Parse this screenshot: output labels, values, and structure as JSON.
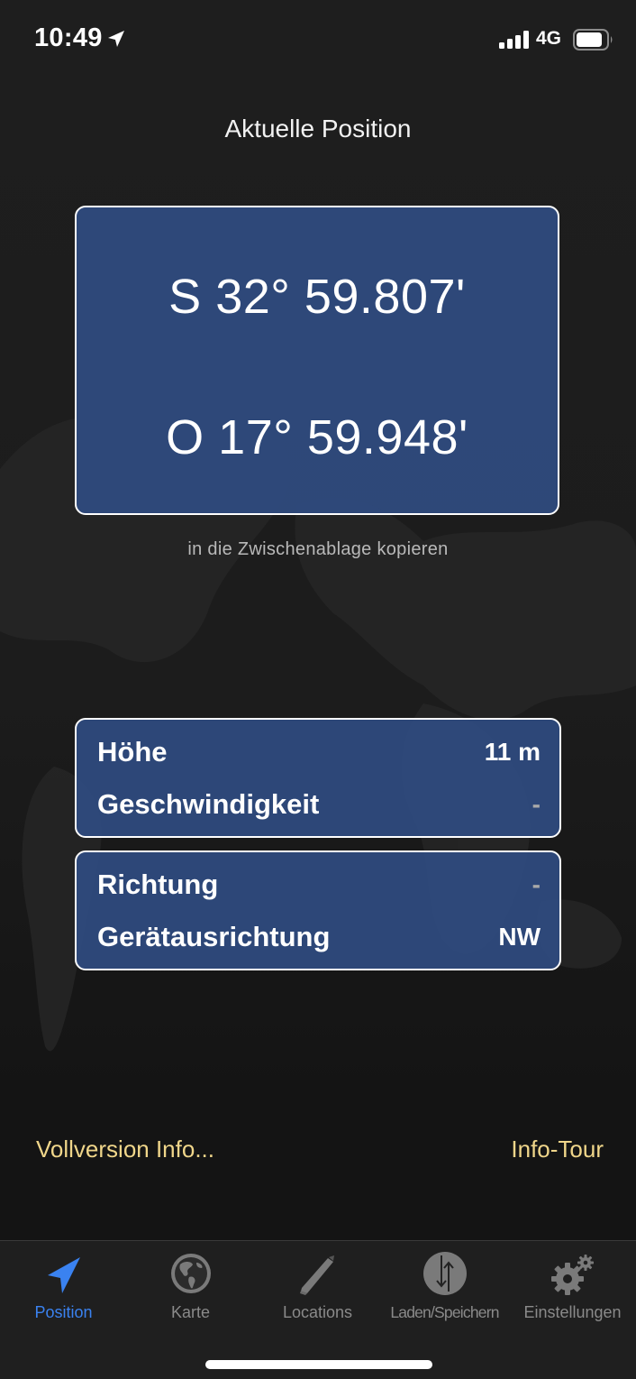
{
  "status_bar": {
    "time": "10:49",
    "network": "4G",
    "icons": [
      "location-arrow-icon",
      "signal-bars-icon",
      "battery-icon"
    ]
  },
  "header": {
    "title": "Aktuelle Position"
  },
  "coordinates": {
    "latitude": "S 32° 59.807'",
    "longitude": "O 17° 59.948'",
    "copy_label": "in die Zwischenablage kopieren"
  },
  "info_cards": [
    {
      "rows": [
        {
          "label": "Höhe",
          "value": "11 m"
        },
        {
          "label": "Geschwindigkeit",
          "value": "-"
        }
      ]
    },
    {
      "rows": [
        {
          "label": "Richtung",
          "value": "-"
        },
        {
          "label": "Gerätausrichtung",
          "value": "NW"
        }
      ]
    }
  ],
  "footer_links": {
    "full_version": "Vollversion Info...",
    "tour": "Info-Tour"
  },
  "tab_bar": {
    "active": "Position",
    "tabs": [
      {
        "label": "Position",
        "icon": "navigation-arrow-icon"
      },
      {
        "label": "Karte",
        "icon": "globe-icon"
      },
      {
        "label": "Locations",
        "icon": "pencil-icon"
      },
      {
        "label": "Laden/Speichern",
        "icon": "load-save-arrows-icon"
      },
      {
        "label": "Einstellungen",
        "icon": "gears-icon"
      }
    ]
  },
  "colors": {
    "background": "#1b1b1b",
    "card_fill": "#2e497c",
    "card_border": "#ffffff",
    "link_gold": "#f0d68a",
    "tab_active": "#3a82f0",
    "tab_inactive": "#8a8a8a"
  }
}
